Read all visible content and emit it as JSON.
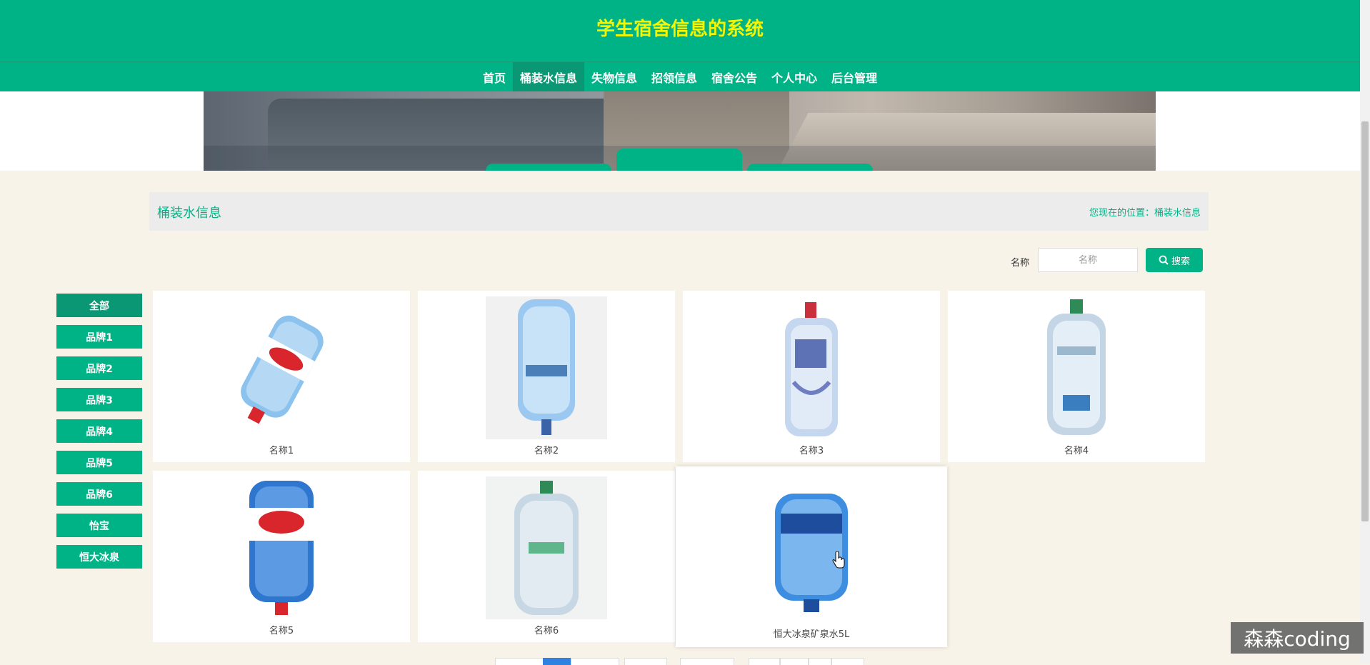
{
  "header": {
    "title": "学生宿舍信息的系统",
    "nav": [
      {
        "label": "首页",
        "name": "nav-home"
      },
      {
        "label": "桶装水信息",
        "name": "nav-water",
        "active": true
      },
      {
        "label": "失物信息",
        "name": "nav-lost"
      },
      {
        "label": "招领信息",
        "name": "nav-found"
      },
      {
        "label": "宿舍公告",
        "name": "nav-notice"
      },
      {
        "label": "个人中心",
        "name": "nav-profile"
      },
      {
        "label": "后台管理",
        "name": "nav-admin"
      }
    ]
  },
  "breadcrumb": {
    "title": "桶装水信息",
    "location": "您现在的位置：桶装水信息"
  },
  "search": {
    "label": "名称",
    "placeholder": "名称",
    "button_label": "搜索"
  },
  "categories": [
    "全部",
    "品牌1",
    "品牌2",
    "品牌3",
    "品牌4",
    "品牌5",
    "品牌6",
    "怡宝",
    "恒大冰泉"
  ],
  "products": [
    {
      "name": "名称1"
    },
    {
      "name": "名称2"
    },
    {
      "name": "名称3"
    },
    {
      "name": "名称4"
    },
    {
      "name": "名称5"
    },
    {
      "name": "名称6"
    },
    {
      "name": "恒大冰泉矿泉水5L"
    }
  ],
  "watermark": "森森coding",
  "colors": {
    "primary": "#00b386",
    "primary_dark": "#0a9773",
    "title_yellow": "#f5f500",
    "page_bg": "#f8f3e8"
  }
}
